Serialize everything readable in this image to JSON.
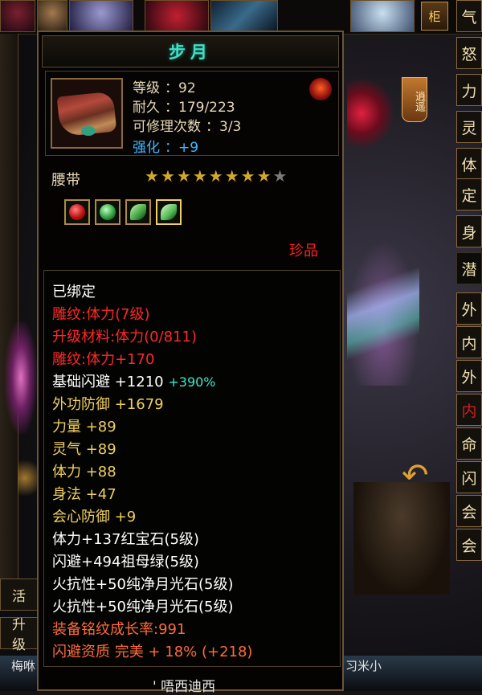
{
  "scene": {
    "cabinet_label": "柜",
    "xiaoyao_label": "逍遥",
    "row_labels": [
      "活",
      "升级"
    ],
    "bottom_left_name": "梅咻",
    "bottom_right_name": "习米小"
  },
  "stat_tabs": [
    "气",
    "怒",
    "力",
    "灵",
    "体",
    "定",
    "身",
    "潜",
    "外",
    "内",
    "外",
    "内",
    "命",
    "闪",
    "会",
    "会"
  ],
  "item": {
    "name": "步月",
    "level_label": "等级",
    "level_value": "：92",
    "durability_label": "耐久",
    "durability_value": "：179/223",
    "repair_label": "可修理次数",
    "repair_value": "：3/3",
    "strength_label": "强化",
    "strength_value": "：+9",
    "slot": "腰带",
    "stars_filled": 8,
    "stars_total": 9,
    "gems": [
      "red",
      "green",
      "leaf",
      "leaf"
    ],
    "rarity": "珍品"
  },
  "stats": {
    "bound": "已绑定",
    "engrave1": "雕纹:体力(7级)",
    "upgrade_material": "升级材料:体力(0/811)",
    "engrave2": "雕纹:体力+170",
    "base_dodge": "基础闪避 +1210",
    "base_dodge_pct": "+390%",
    "ext_defense": "外功防御 +1679",
    "power": "力量 +89",
    "spirit": "灵气 +89",
    "physique": "体力 +88",
    "agility": "身法 +47",
    "crit_defense": "会心防御 +9",
    "gem1": "体力+137红宝石(5级)",
    "gem2": "闪避+494祖母绿(5级)",
    "gem3": "火抗性+50纯净月光石(5级)",
    "gem4": "火抗性+50纯净月光石(5级)",
    "growth": "装备铭纹成长率:991",
    "dodge_quality": "闪避资质 完美 + 18% (+218)"
  },
  "footer": "' 唔西迪西"
}
